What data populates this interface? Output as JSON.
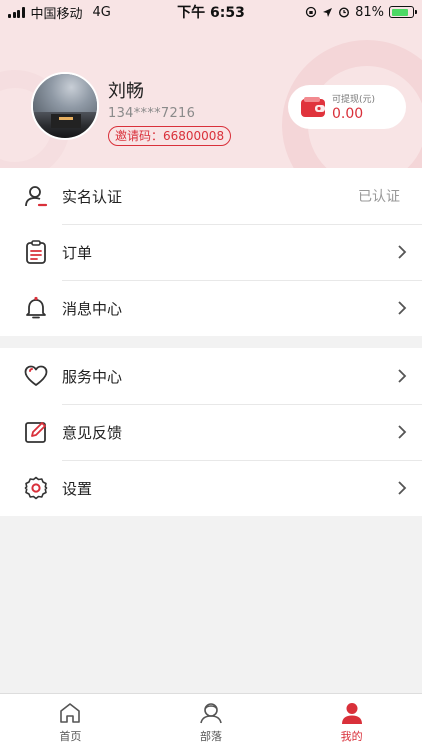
{
  "status_bar": {
    "carrier": "中国移动",
    "network": "4G",
    "time": "下午 6:53",
    "battery_percent_text": "81%",
    "battery_level": 0.81
  },
  "profile": {
    "name": "刘畅",
    "phone": "134****7216",
    "invite_code": "邀请码：66800008",
    "avatar_icon": "avatar-photo"
  },
  "wallet": {
    "label": "可提现(元)",
    "amount": "0.00",
    "icon": "wallet-icon"
  },
  "menu_group1": [
    {
      "label": "实名认证",
      "value": "已认证",
      "icon": "user-verify-icon"
    },
    {
      "label": "订单",
      "icon": "clipboard-icon"
    },
    {
      "label": "消息中心",
      "icon": "bell-icon"
    }
  ],
  "menu_group2": [
    {
      "label": "服务中心",
      "icon": "heart-icon"
    },
    {
      "label": "意见反馈",
      "icon": "edit-icon"
    },
    {
      "label": "设置",
      "icon": "gear-icon"
    }
  ],
  "tabbar": {
    "tabs": [
      {
        "label": "首页",
        "icon": "home-icon"
      },
      {
        "label": "部落",
        "icon": "tribe-icon"
      },
      {
        "label": "我的",
        "icon": "profile-icon"
      }
    ],
    "active_index": 2
  },
  "colors": {
    "accent": "#d9303a",
    "header_bg": "#f8e4e5",
    "page_bg": "#f2f2f2"
  }
}
